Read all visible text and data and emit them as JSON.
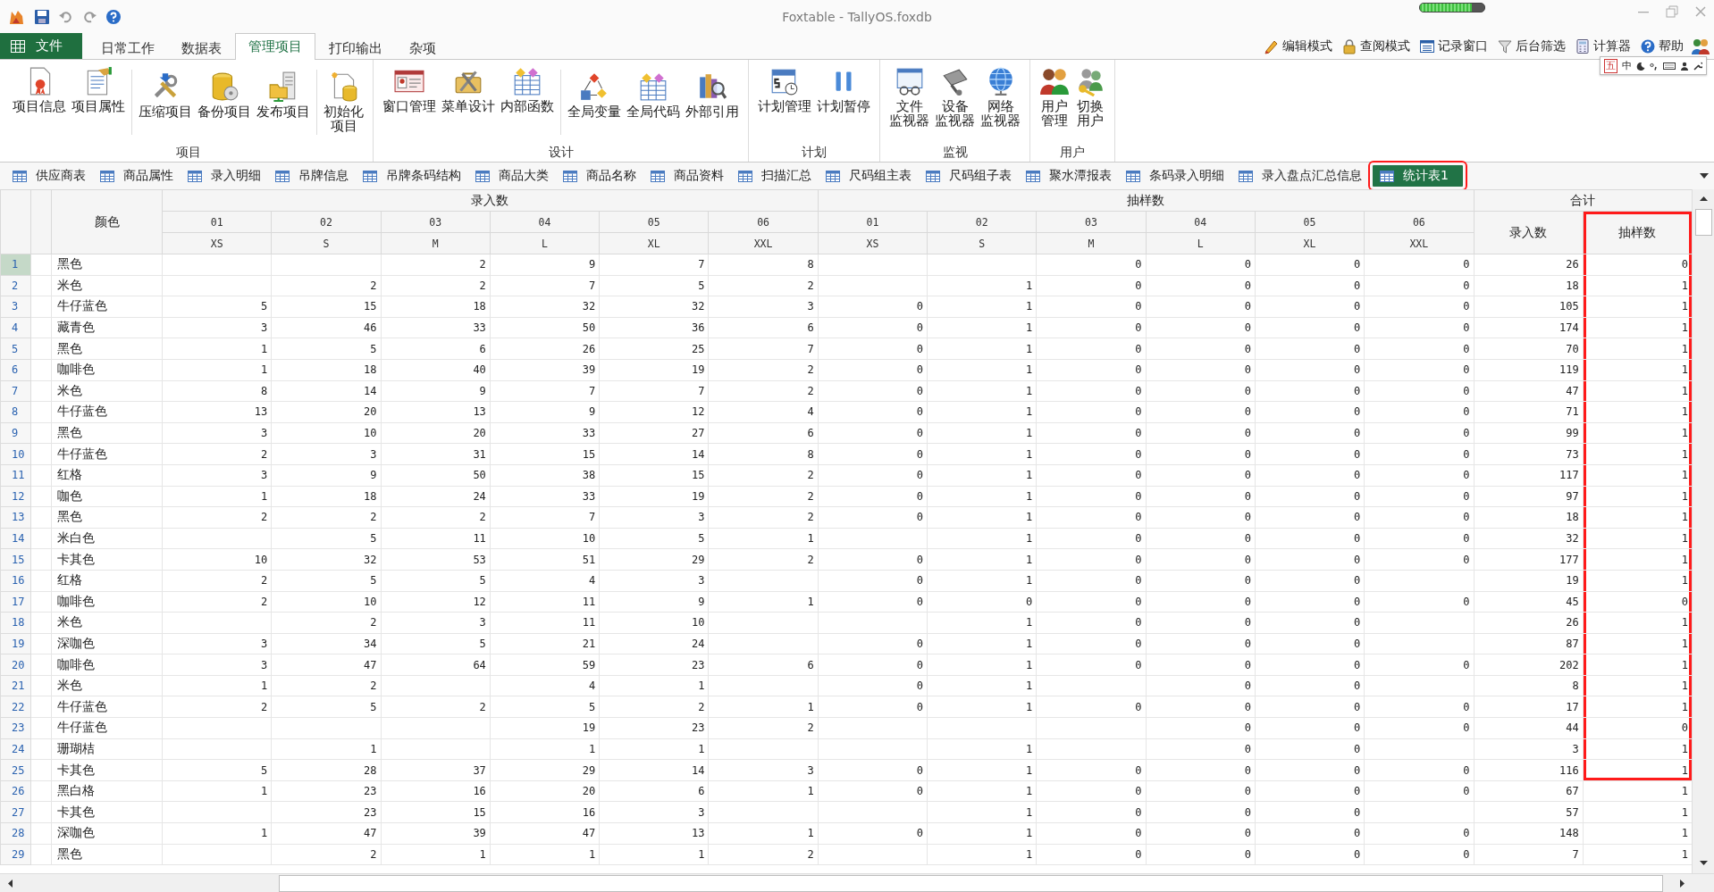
{
  "window": {
    "title": "Foxtable - TallyOS.foxdb",
    "progress": {
      "level": 0.8
    }
  },
  "menu": {
    "tabs": [
      {
        "label": "文件",
        "kind": "file",
        "selected": false
      },
      {
        "label": "日常工作",
        "kind": "tab",
        "selected": false
      },
      {
        "label": "数据表",
        "kind": "tab",
        "selected": false
      },
      {
        "label": "管理项目",
        "kind": "tab",
        "selected": true
      },
      {
        "label": "打印输出",
        "kind": "tab",
        "selected": false
      },
      {
        "label": "杂项",
        "kind": "tab",
        "selected": false
      }
    ],
    "tools": [
      {
        "label": "编辑模式"
      },
      {
        "label": "查阅模式"
      },
      {
        "label": "记录窗口"
      },
      {
        "label": "后台筛选"
      },
      {
        "label": "计算器"
      },
      {
        "label": "帮助"
      }
    ]
  },
  "ime_bar": [
    "五",
    "中"
  ],
  "ribbon": {
    "groups": [
      {
        "label": "项目",
        "sections": [
          [
            {
              "lines": [
                "项目信息"
              ]
            },
            {
              "lines": [
                "项目属性"
              ]
            }
          ],
          [
            {
              "lines": [
                "压缩项目"
              ]
            },
            {
              "lines": [
                "备份项目"
              ]
            },
            {
              "lines": [
                "发布项目"
              ]
            }
          ],
          [
            {
              "lines": [
                "初始化",
                "项目"
              ]
            }
          ]
        ]
      },
      {
        "label": "设计",
        "sections": [
          [
            {
              "lines": [
                "窗口管理"
              ]
            },
            {
              "lines": [
                "菜单设计"
              ]
            },
            {
              "lines": [
                "内部函数"
              ]
            }
          ],
          [
            {
              "lines": [
                "全局变量"
              ]
            },
            {
              "lines": [
                "全局代码"
              ]
            },
            {
              "lines": [
                "外部引用"
              ]
            }
          ]
        ]
      },
      {
        "label": "计划",
        "sections": [
          [
            {
              "lines": [
                "计划管理"
              ]
            },
            {
              "lines": [
                "计划暂停"
              ]
            }
          ]
        ]
      },
      {
        "label": "监视",
        "sections": [
          [
            {
              "lines": [
                "文件",
                "监视器"
              ]
            },
            {
              "lines": [
                "设备",
                "监视器"
              ]
            },
            {
              "lines": [
                "网络",
                "监视器"
              ]
            }
          ]
        ]
      },
      {
        "label": "用户",
        "sections": [
          [
            {
              "lines": [
                "用户",
                "管理"
              ]
            },
            {
              "lines": [
                "切换",
                "用户"
              ]
            }
          ]
        ]
      }
    ]
  },
  "table_tabs": [
    {
      "label": "供应商表",
      "selected": false,
      "highlighted": false
    },
    {
      "label": "商品属性",
      "selected": false,
      "highlighted": false
    },
    {
      "label": "录入明细",
      "selected": false,
      "highlighted": false
    },
    {
      "label": "吊牌信息",
      "selected": false,
      "highlighted": false
    },
    {
      "label": "吊牌条码结构",
      "selected": false,
      "highlighted": false
    },
    {
      "label": "商品大类",
      "selected": false,
      "highlighted": false
    },
    {
      "label": "商品名称",
      "selected": false,
      "highlighted": false
    },
    {
      "label": "商品资料",
      "selected": false,
      "highlighted": false
    },
    {
      "label": "扫描汇总",
      "selected": false,
      "highlighted": false
    },
    {
      "label": "尺码组主表",
      "selected": false,
      "highlighted": false
    },
    {
      "label": "尺码组子表",
      "selected": false,
      "highlighted": false
    },
    {
      "label": "聚水潭报表",
      "selected": false,
      "highlighted": false
    },
    {
      "label": "条码录入明细",
      "selected": false,
      "highlighted": false
    },
    {
      "label": "录入盘点汇总信息",
      "selected": false,
      "highlighted": false
    },
    {
      "label": "统计表1",
      "selected": true,
      "highlighted": true
    }
  ],
  "grid": {
    "label_column": "颜色",
    "groups": [
      {
        "label": "录入数",
        "columns": [
          {
            "code": "01",
            "size": "XS"
          },
          {
            "code": "02",
            "size": "S"
          },
          {
            "code": "03",
            "size": "M"
          },
          {
            "code": "04",
            "size": "L"
          },
          {
            "code": "05",
            "size": "XL"
          },
          {
            "code": "06",
            "size": "XXL"
          }
        ]
      },
      {
        "label": "抽样数",
        "columns": [
          {
            "code": "01",
            "size": "XS"
          },
          {
            "code": "02",
            "size": "S"
          },
          {
            "code": "03",
            "size": "M"
          },
          {
            "code": "04",
            "size": "L"
          },
          {
            "code": "05",
            "size": "XL"
          },
          {
            "code": "06",
            "size": "XXL"
          }
        ]
      }
    ],
    "total": {
      "label": "合计",
      "columns": [
        {
          "label": "录入数",
          "highlighted": false
        },
        {
          "label": "抽样数",
          "highlighted": true
        }
      ]
    },
    "rows": [
      {
        "number": "1",
        "label": "黑色",
        "entered": {
          "c3": "2",
          "c4": "9",
          "c5": "7",
          "c6": "8"
        },
        "sampled": {
          "c3": "0",
          "c4": "0",
          "c5": "0",
          "c6": "0"
        },
        "total_entered": "26",
        "total_sampled": "0",
        "selected": true,
        "highlight": true
      },
      {
        "number": "2",
        "label": "米色",
        "entered": {
          "c2": "2",
          "c3": "2",
          "c4": "7",
          "c5": "5",
          "c6": "2"
        },
        "sampled": {
          "c2": "1",
          "c3": "0",
          "c4": "0",
          "c5": "0",
          "c6": "0"
        },
        "total_entered": "18",
        "total_sampled": "1",
        "selected": false,
        "highlight": true
      },
      {
        "number": "3",
        "label": "牛仔蓝色",
        "entered": {
          "c1": "5",
          "c2": "15",
          "c3": "18",
          "c4": "32",
          "c5": "32",
          "c6": "3"
        },
        "sampled": {
          "c1": "0",
          "c2": "1",
          "c3": "0",
          "c4": "0",
          "c5": "0",
          "c6": "0"
        },
        "total_entered": "105",
        "total_sampled": "1",
        "selected": false,
        "highlight": true
      },
      {
        "number": "4",
        "label": "藏青色",
        "entered": {
          "c1": "3",
          "c2": "46",
          "c3": "33",
          "c4": "50",
          "c5": "36",
          "c6": "6"
        },
        "sampled": {
          "c1": "0",
          "c2": "1",
          "c3": "0",
          "c4": "0",
          "c5": "0",
          "c6": "0"
        },
        "total_entered": "174",
        "total_sampled": "1",
        "selected": false,
        "highlight": true
      },
      {
        "number": "5",
        "label": "黑色",
        "entered": {
          "c1": "1",
          "c2": "5",
          "c3": "6",
          "c4": "26",
          "c5": "25",
          "c6": "7"
        },
        "sampled": {
          "c1": "0",
          "c2": "1",
          "c3": "0",
          "c4": "0",
          "c5": "0",
          "c6": "0"
        },
        "total_entered": "70",
        "total_sampled": "1",
        "selected": false,
        "highlight": true
      },
      {
        "number": "6",
        "label": "咖啡色",
        "entered": {
          "c1": "1",
          "c2": "18",
          "c3": "40",
          "c4": "39",
          "c5": "19",
          "c6": "2"
        },
        "sampled": {
          "c1": "0",
          "c2": "1",
          "c3": "0",
          "c4": "0",
          "c5": "0",
          "c6": "0"
        },
        "total_entered": "119",
        "total_sampled": "1",
        "selected": false,
        "highlight": true
      },
      {
        "number": "7",
        "label": "米色",
        "entered": {
          "c1": "8",
          "c2": "14",
          "c3": "9",
          "c4": "7",
          "c5": "7",
          "c6": "2"
        },
        "sampled": {
          "c1": "0",
          "c2": "1",
          "c3": "0",
          "c4": "0",
          "c5": "0",
          "c6": "0"
        },
        "total_entered": "47",
        "total_sampled": "1",
        "selected": false,
        "highlight": true
      },
      {
        "number": "8",
        "label": "牛仔蓝色",
        "entered": {
          "c1": "13",
          "c2": "20",
          "c3": "13",
          "c4": "9",
          "c5": "12",
          "c6": "4"
        },
        "sampled": {
          "c1": "0",
          "c2": "1",
          "c3": "0",
          "c4": "0",
          "c5": "0",
          "c6": "0"
        },
        "total_entered": "71",
        "total_sampled": "1",
        "selected": false,
        "highlight": true
      },
      {
        "number": "9",
        "label": "黑色",
        "entered": {
          "c1": "3",
          "c2": "10",
          "c3": "20",
          "c4": "33",
          "c5": "27",
          "c6": "6"
        },
        "sampled": {
          "c1": "0",
          "c2": "1",
          "c3": "0",
          "c4": "0",
          "c5": "0",
          "c6": "0"
        },
        "total_entered": "99",
        "total_sampled": "1",
        "selected": false,
        "highlight": true
      },
      {
        "number": "10",
        "label": "牛仔蓝色",
        "entered": {
          "c1": "2",
          "c2": "3",
          "c3": "31",
          "c4": "15",
          "c5": "14",
          "c6": "8"
        },
        "sampled": {
          "c1": "0",
          "c2": "1",
          "c3": "0",
          "c4": "0",
          "c5": "0",
          "c6": "0"
        },
        "total_entered": "73",
        "total_sampled": "1",
        "selected": false,
        "highlight": true
      },
      {
        "number": "11",
        "label": "红格",
        "entered": {
          "c1": "3",
          "c2": "9",
          "c3": "50",
          "c4": "38",
          "c5": "15",
          "c6": "2"
        },
        "sampled": {
          "c1": "0",
          "c2": "1",
          "c3": "0",
          "c4": "0",
          "c5": "0",
          "c6": "0"
        },
        "total_entered": "117",
        "total_sampled": "1",
        "selected": false,
        "highlight": true
      },
      {
        "number": "12",
        "label": "咖色",
        "entered": {
          "c1": "1",
          "c2": "18",
          "c3": "24",
          "c4": "33",
          "c5": "19",
          "c6": "2"
        },
        "sampled": {
          "c1": "0",
          "c2": "1",
          "c3": "0",
          "c4": "0",
          "c5": "0",
          "c6": "0"
        },
        "total_entered": "97",
        "total_sampled": "1",
        "selected": false,
        "highlight": true
      },
      {
        "number": "13",
        "label": "黑色",
        "entered": {
          "c1": "2",
          "c2": "2",
          "c3": "2",
          "c4": "7",
          "c5": "3",
          "c6": "2"
        },
        "sampled": {
          "c1": "0",
          "c2": "1",
          "c3": "0",
          "c4": "0",
          "c5": "0",
          "c6": "0"
        },
        "total_entered": "18",
        "total_sampled": "1",
        "selected": false,
        "highlight": true
      },
      {
        "number": "14",
        "label": "米白色",
        "entered": {
          "c2": "5",
          "c3": "11",
          "c4": "10",
          "c5": "5",
          "c6": "1"
        },
        "sampled": {
          "c2": "1",
          "c3": "0",
          "c4": "0",
          "c5": "0",
          "c6": "0"
        },
        "total_entered": "32",
        "total_sampled": "1",
        "selected": false,
        "highlight": true
      },
      {
        "number": "15",
        "label": "卡其色",
        "entered": {
          "c1": "10",
          "c2": "32",
          "c3": "53",
          "c4": "51",
          "c5": "29",
          "c6": "2"
        },
        "sampled": {
          "c1": "0",
          "c2": "1",
          "c3": "0",
          "c4": "0",
          "c5": "0",
          "c6": "0"
        },
        "total_entered": "177",
        "total_sampled": "1",
        "selected": false,
        "highlight": true
      },
      {
        "number": "16",
        "label": "红格",
        "entered": {
          "c1": "2",
          "c2": "5",
          "c3": "5",
          "c4": "4",
          "c5": "3"
        },
        "sampled": {
          "c1": "0",
          "c2": "1",
          "c3": "0",
          "c4": "0",
          "c5": "0"
        },
        "total_entered": "19",
        "total_sampled": "1",
        "selected": false,
        "highlight": true
      },
      {
        "number": "17",
        "label": "咖啡色",
        "entered": {
          "c1": "2",
          "c2": "10",
          "c3": "12",
          "c4": "11",
          "c5": "9",
          "c6": "1"
        },
        "sampled": {
          "c1": "0",
          "c2": "0",
          "c3": "0",
          "c4": "0",
          "c5": "0",
          "c6": "0"
        },
        "total_entered": "45",
        "total_sampled": "0",
        "selected": false,
        "highlight": true
      },
      {
        "number": "18",
        "label": "米色",
        "entered": {
          "c2": "2",
          "c3": "3",
          "c4": "11",
          "c5": "10"
        },
        "sampled": {
          "c2": "1",
          "c3": "0",
          "c4": "0",
          "c5": "0"
        },
        "total_entered": "26",
        "total_sampled": "1",
        "selected": false,
        "highlight": true
      },
      {
        "number": "19",
        "label": "深咖色",
        "entered": {
          "c1": "3",
          "c2": "34",
          "c3": "5",
          "c4": "21",
          "c5": "24"
        },
        "sampled": {
          "c1": "0",
          "c2": "1",
          "c3": "0",
          "c4": "0",
          "c5": "0"
        },
        "total_entered": "87",
        "total_sampled": "1",
        "selected": false,
        "highlight": true
      },
      {
        "number": "20",
        "label": "咖啡色",
        "entered": {
          "c1": "3",
          "c2": "47",
          "c3": "64",
          "c4": "59",
          "c5": "23",
          "c6": "6"
        },
        "sampled": {
          "c1": "0",
          "c2": "1",
          "c3": "0",
          "c4": "0",
          "c5": "0",
          "c6": "0"
        },
        "total_entered": "202",
        "total_sampled": "1",
        "selected": false,
        "highlight": true
      },
      {
        "number": "21",
        "label": "米色",
        "entered": {
          "c1": "1",
          "c2": "2",
          "c4": "4",
          "c5": "1"
        },
        "sampled": {
          "c1": "0",
          "c2": "1",
          "c4": "0",
          "c5": "0"
        },
        "total_entered": "8",
        "total_sampled": "1",
        "selected": false,
        "highlight": true
      },
      {
        "number": "22",
        "label": "牛仔蓝色",
        "entered": {
          "c1": "2",
          "c2": "5",
          "c3": "2",
          "c4": "5",
          "c5": "2",
          "c6": "1"
        },
        "sampled": {
          "c1": "0",
          "c2": "1",
          "c3": "0",
          "c4": "0",
          "c5": "0",
          "c6": "0"
        },
        "total_entered": "17",
        "total_sampled": "1",
        "selected": false,
        "highlight": true
      },
      {
        "number": "23",
        "label": "牛仔蓝色",
        "entered": {
          "c4": "19",
          "c5": "23",
          "c6": "2"
        },
        "sampled": {
          "c4": "0",
          "c5": "0",
          "c6": "0"
        },
        "total_entered": "44",
        "total_sampled": "0",
        "selected": false,
        "highlight": true
      },
      {
        "number": "24",
        "label": "珊瑚桔",
        "entered": {
          "c2": "1",
          "c4": "1",
          "c5": "1"
        },
        "sampled": {
          "c2": "1",
          "c4": "0",
          "c5": "0"
        },
        "total_entered": "3",
        "total_sampled": "1",
        "selected": false,
        "highlight": true
      },
      {
        "number": "25",
        "label": "卡其色",
        "entered": {
          "c1": "5",
          "c2": "28",
          "c3": "37",
          "c4": "29",
          "c5": "14",
          "c6": "3"
        },
        "sampled": {
          "c1": "0",
          "c2": "1",
          "c3": "0",
          "c4": "0",
          "c5": "0",
          "c6": "0"
        },
        "total_entered": "116",
        "total_sampled": "1",
        "selected": false,
        "highlight": true
      },
      {
        "number": "26",
        "label": "黑白格",
        "entered": {
          "c1": "1",
          "c2": "23",
          "c3": "16",
          "c4": "20",
          "c5": "6",
          "c6": "1"
        },
        "sampled": {
          "c1": "0",
          "c2": "1",
          "c3": "0",
          "c4": "0",
          "c5": "0",
          "c6": "0"
        },
        "total_entered": "67",
        "total_sampled": "1",
        "selected": false,
        "highlight": false
      },
      {
        "number": "27",
        "label": "卡其色",
        "entered": {
          "c2": "23",
          "c3": "15",
          "c4": "16",
          "c5": "3"
        },
        "sampled": {
          "c2": "1",
          "c3": "0",
          "c4": "0",
          "c5": "0"
        },
        "total_entered": "57",
        "total_sampled": "1",
        "selected": false,
        "highlight": false
      },
      {
        "number": "28",
        "label": "深咖色",
        "entered": {
          "c1": "1",
          "c2": "47",
          "c3": "39",
          "c4": "47",
          "c5": "13",
          "c6": "1"
        },
        "sampled": {
          "c1": "0",
          "c2": "1",
          "c3": "0",
          "c4": "0",
          "c5": "0",
          "c6": "0"
        },
        "total_entered": "148",
        "total_sampled": "1",
        "selected": false,
        "highlight": false
      },
      {
        "number": "29",
        "label": "黑色",
        "entered": {
          "c2": "2",
          "c3": "1",
          "c4": "1",
          "c5": "1",
          "c6": "2"
        },
        "sampled": {
          "c2": "1",
          "c3": "0",
          "c4": "0",
          "c5": "0",
          "c6": "0"
        },
        "total_entered": "7",
        "total_sampled": "1",
        "selected": false,
        "highlight": false
      }
    ]
  }
}
